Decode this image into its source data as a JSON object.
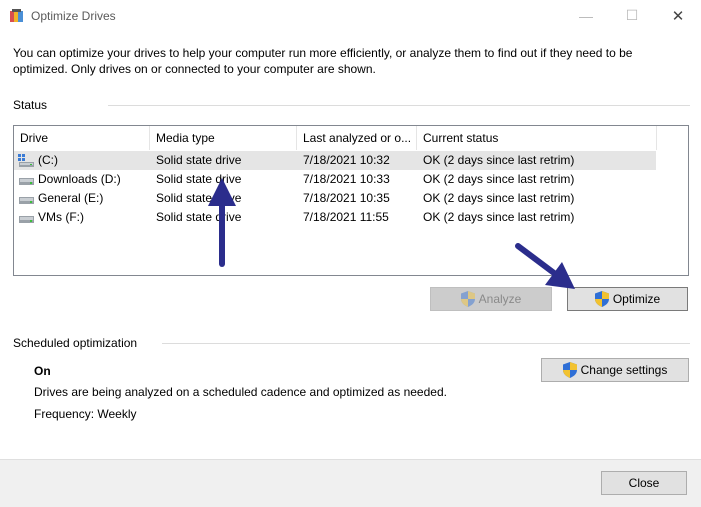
{
  "window": {
    "title": "Optimize Drives",
    "min_glyph": "—",
    "max_glyph": "☐",
    "close_glyph": "✕"
  },
  "description": "You can optimize your drives to help your computer run more efficiently, or analyze them to find out if they need to be optimized. Only drives on or connected to your computer are shown.",
  "status": {
    "label": "Status",
    "columns": [
      "Drive",
      "Media type",
      "Last analyzed or o...",
      "Current status"
    ],
    "drives": [
      {
        "drive": "(C:)",
        "media_type": "Solid state drive",
        "last_analyzed": "7/18/2021 10:32",
        "current_status": "OK (2 days since last retrim)",
        "icon": "system-drive-icon"
      },
      {
        "drive": "Downloads (D:)",
        "media_type": "Solid state drive",
        "last_analyzed": "7/18/2021 10:33",
        "current_status": "OK (2 days since last retrim)",
        "icon": "drive-icon"
      },
      {
        "drive": "General (E:)",
        "media_type": "Solid state drive",
        "last_analyzed": "7/18/2021 10:35",
        "current_status": "OK (2 days since last retrim)",
        "icon": "drive-icon"
      },
      {
        "drive": "VMs (F:)",
        "media_type": "Solid state drive",
        "last_analyzed": "7/18/2021 11:55",
        "current_status": "OK (2 days since last retrim)",
        "icon": "drive-icon"
      }
    ]
  },
  "actions": {
    "analyze_label": "Analyze",
    "optimize_label": "Optimize"
  },
  "scheduled": {
    "label": "Scheduled optimization",
    "state": "On",
    "description": "Drives are being analyzed on a scheduled cadence and optimized as needed.",
    "frequency": "Frequency: Weekly",
    "change_settings_label": "Change settings"
  },
  "footer": {
    "close_label": "Close"
  },
  "colors": {
    "annotation_arrow": "#2b2d8c",
    "selected_row": "#e5e5e5",
    "button_face": "#e1e1e1",
    "disabled_button": "#cccccc"
  }
}
